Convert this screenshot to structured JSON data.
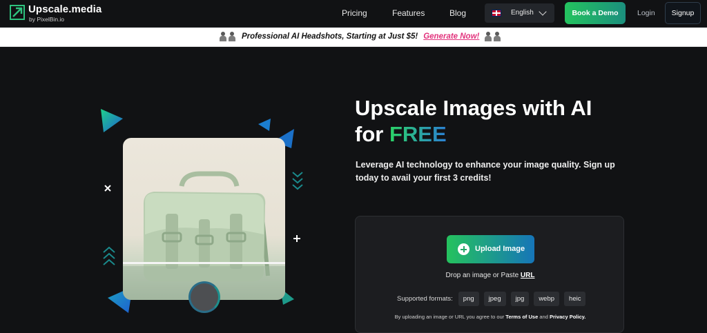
{
  "nav": {
    "logo_title": "Upscale.media",
    "logo_sub": "by PixelBin.io",
    "links": [
      "Pricing",
      "Features",
      "Blog"
    ],
    "language": "English",
    "book_demo": "Book a Demo",
    "login": "Login",
    "signup": "Signup"
  },
  "promo": {
    "text": "Professional AI Headshots, Starting at Just $5!",
    "link": "Generate Now!"
  },
  "hero": {
    "title_line1": "Upscale Images with AI",
    "title_for": "for ",
    "title_free": "FREE",
    "subtitle": "Leverage AI technology to enhance your image quality. Sign up today to avail your first 3 credits!"
  },
  "upload": {
    "button": "Upload Image",
    "drop_text": "Drop an image or Paste ",
    "drop_url": "URL",
    "formats_label": "Supported formats:",
    "formats": [
      "png",
      "jpeg",
      "jpg",
      "webp",
      "heic"
    ],
    "terms_prefix": "By uploading an image or URL you agree to our ",
    "terms_link": "Terms of Use",
    "terms_and": " and ",
    "privacy_link": "Privacy Policy."
  },
  "colors": {
    "accent_green": "#24c35f",
    "accent_blue": "#1675b8",
    "promo_link": "#e2337d"
  }
}
